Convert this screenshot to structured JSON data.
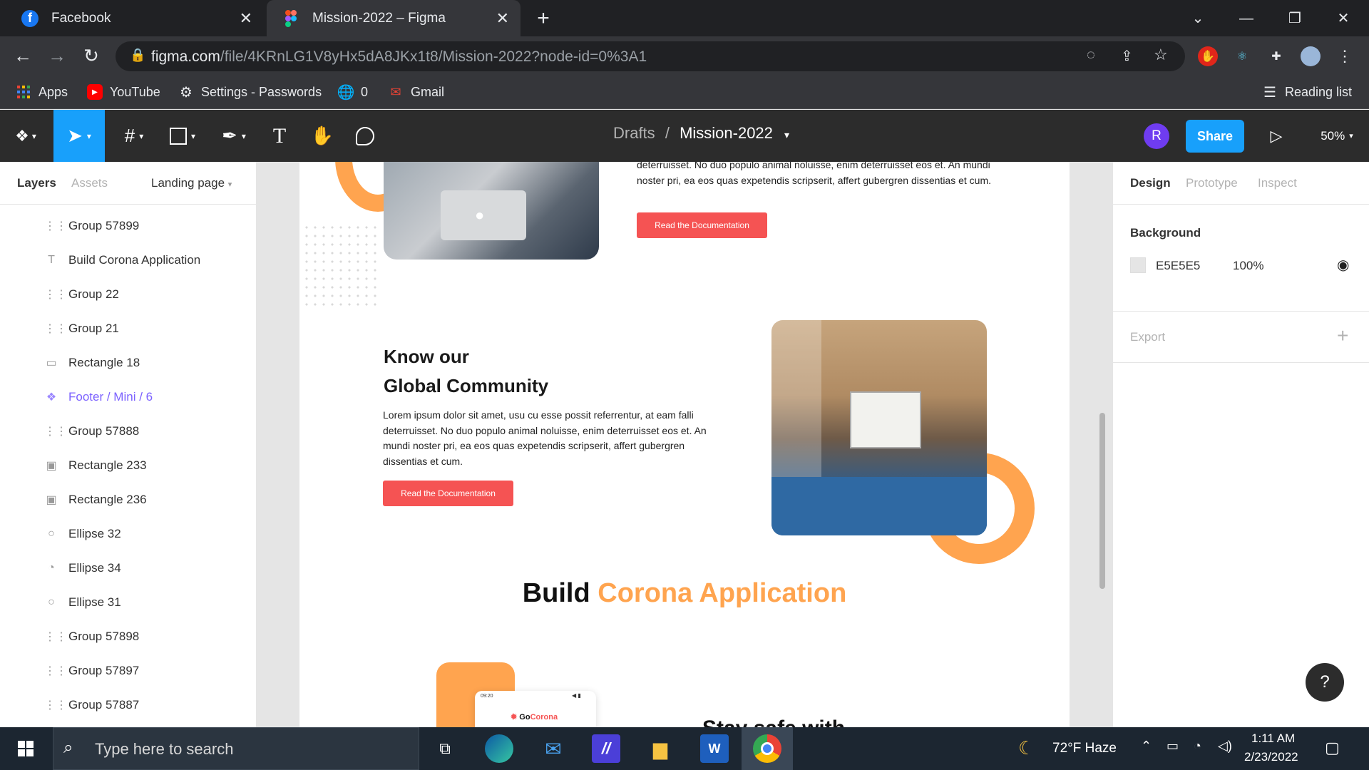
{
  "browser": {
    "tabs": [
      {
        "title": "Facebook",
        "active": false
      },
      {
        "title": "Mission-2022 – Figma",
        "active": true
      }
    ],
    "url_host": "figma.com",
    "url_path": "/file/4KRnLG1V8yHx5dA8JKx1t8/Mission-2022?node-id=0%3A1",
    "bookmarks": [
      {
        "label": "Apps",
        "icon": "apps-grid-icon"
      },
      {
        "label": "YouTube",
        "icon": "youtube-icon"
      },
      {
        "label": "Settings - Passwords",
        "icon": "gear-icon"
      },
      {
        "label": "0",
        "icon": "globe-icon"
      },
      {
        "label": "Gmail",
        "icon": "gmail-icon"
      }
    ],
    "reading_list": "Reading list"
  },
  "figma": {
    "breadcrumb_root": "Drafts",
    "breadcrumb_sep": "/",
    "file_name": "Mission-2022",
    "avatar_initial": "R",
    "share_label": "Share",
    "zoom": "50%",
    "left_tabs": {
      "layers": "Layers",
      "assets": "Assets",
      "page": "Landing page"
    },
    "layers": [
      {
        "name": "Group 57899",
        "icon": "frame-icon",
        "type": "group"
      },
      {
        "name": "Build Corona Application",
        "icon": "text-icon",
        "type": "text"
      },
      {
        "name": "Group 22",
        "icon": "frame-icon",
        "type": "group"
      },
      {
        "name": "Group 21",
        "icon": "frame-icon",
        "type": "group"
      },
      {
        "name": "Rectangle 18",
        "icon": "rectangle-icon",
        "type": "rect"
      },
      {
        "name": "Footer / Mini / 6",
        "icon": "component-icon",
        "type": "component"
      },
      {
        "name": "Group 57888",
        "icon": "frame-icon",
        "type": "group"
      },
      {
        "name": "Rectangle 233",
        "icon": "image-icon",
        "type": "image"
      },
      {
        "name": "Rectangle 236",
        "icon": "image-icon",
        "type": "image"
      },
      {
        "name": "Ellipse 32",
        "icon": "ellipse-icon",
        "type": "ellipse"
      },
      {
        "name": "Ellipse 34",
        "icon": "arc-icon",
        "type": "ellipse"
      },
      {
        "name": "Ellipse 31",
        "icon": "ellipse-icon",
        "type": "ellipse"
      },
      {
        "name": "Group 57898",
        "icon": "frame-icon",
        "type": "group"
      },
      {
        "name": "Group 57897",
        "icon": "frame-icon",
        "type": "group"
      },
      {
        "name": "Group 57887",
        "icon": "frame-icon",
        "type": "group"
      }
    ],
    "right_tabs": {
      "design": "Design",
      "prototype": "Prototype",
      "inspect": "Inspect"
    },
    "background_label": "Background",
    "background_hex": "E5E5E5",
    "background_opacity": "100%",
    "export_label": "Export",
    "help": "?"
  },
  "design": {
    "top_para": "deterruisset. No duo populo animal noluisse, enim deterruisset eos et. An mundi noster pri, ea eos quas expetendis scripserit, affert gubergren dissentias et cum.",
    "btn1": "Read the  Documentation",
    "heading_line1": "Know our",
    "heading_line2": "Global Community",
    "community_para": "Lorem ipsum dolor sit amet, usu cu esse possit referrentur, at eam falli deterruisset. No duo populo animal noluisse, enim deterruisset eos et. An mundi noster pri, ea eos quas expetendis scripserit, affert gubergren dissentias et cum.",
    "btn2": "Read the  Documentation",
    "build_word": "Build",
    "build_accent": "Corona Application",
    "phone_time": "09:20",
    "gocorona_go": "Go",
    "gocorona_corona": "Corona",
    "partial_heading": "Stay safe with",
    "accent_color": "#ffa44f",
    "button_color": "#f55353"
  },
  "taskbar": {
    "search_placeholder": "Type here to search",
    "weather": "72°F  Haze",
    "time": "1:11 AM",
    "date": "2/23/2022"
  }
}
